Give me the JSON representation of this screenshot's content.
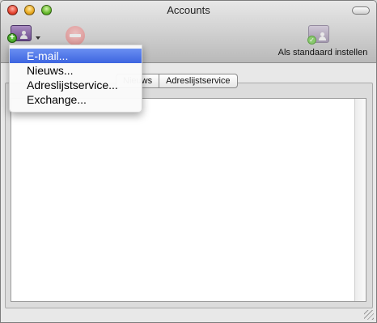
{
  "window": {
    "title": "Accounts"
  },
  "toolbar": {
    "add_icon": "add-account-icon",
    "remove_icon": "remove-account-icon",
    "set_default_label": "Als standaard instellen",
    "set_default_icon": "default-account-icon"
  },
  "tabs": [
    {
      "label": "Nieuws"
    },
    {
      "label": "Adreslijstservice"
    }
  ],
  "menu": {
    "items": [
      {
        "label": "E-mail...",
        "selected": true
      },
      {
        "label": "Nieuws..."
      },
      {
        "label": "Adreslijstservice..."
      },
      {
        "label": "Exchange..."
      }
    ]
  },
  "colors": {
    "selection": "#3d65e0",
    "close": "#e4432f",
    "minimize": "#e8a81e",
    "zoom": "#65b82b"
  }
}
